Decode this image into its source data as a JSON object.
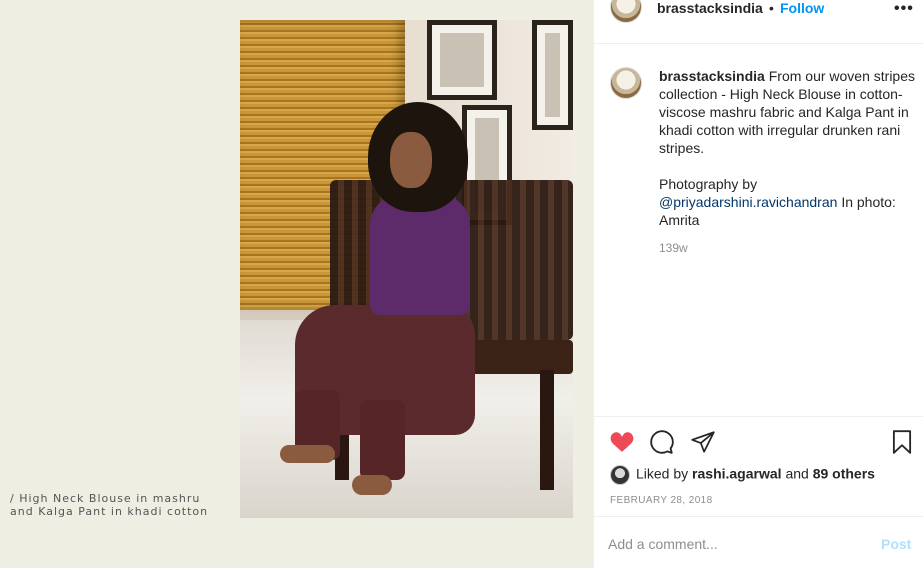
{
  "post": {
    "image_caption_line1": "/ High Neck Blouse in mashru",
    "image_caption_line2": "and Kalga Pant in khadi cotton"
  },
  "header": {
    "username": "brasstacksindia",
    "separator": "•",
    "follow_label": "Follow",
    "more_label": "•••"
  },
  "comment": {
    "username": "brasstacksindia",
    "text_part1": "From our woven stripes collection - High Neck Blouse in cotton-viscose mashru fabric and Kalga Pant in khadi cotton with irregular drunken rani stripes.",
    "text_part2_prefix": "Photography by",
    "mention": "@priyadarshini.ravichandran",
    "text_part2_suffix": "In photo: Amrita",
    "time": "139w"
  },
  "actions": {
    "icons": [
      "heart-icon",
      "comment-icon",
      "share-icon",
      "bookmark-icon"
    ],
    "liked": true
  },
  "likes": {
    "prefix": "Liked by",
    "user": "rashi.agarwal",
    "joiner": "and",
    "others": "89 others"
  },
  "date": "FEBRUARY 28, 2018",
  "add_comment": {
    "placeholder": "Add a comment...",
    "post_label": "Post"
  },
  "colors": {
    "accent": "#0095f6",
    "like": "#ed4956",
    "post_disabled": "#b2dffc"
  }
}
